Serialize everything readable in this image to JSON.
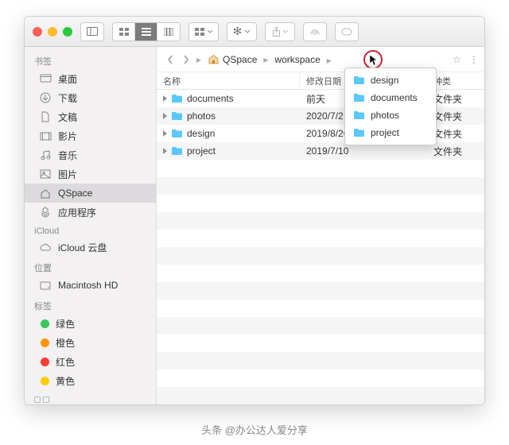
{
  "sidebar": {
    "bookmarks_title": "书签",
    "items": [
      {
        "label": "桌面"
      },
      {
        "label": "下载"
      },
      {
        "label": "文稿"
      },
      {
        "label": "影片"
      },
      {
        "label": "音乐"
      },
      {
        "label": "图片"
      },
      {
        "label": "QSpace"
      },
      {
        "label": "应用程序"
      }
    ],
    "icloud_title": "iCloud",
    "icloud_item": "iCloud 云盘",
    "locations_title": "位置",
    "location_item": "Macintosh HD",
    "tags_title": "标签",
    "tags": [
      {
        "label": "绿色",
        "color": "#34c759"
      },
      {
        "label": "橙色",
        "color": "#ff9500"
      },
      {
        "label": "红色",
        "color": "#ff3b30"
      },
      {
        "label": "黄色",
        "color": "#ffcc00"
      }
    ]
  },
  "breadcrumb": {
    "root": "QSpace",
    "child": "workspace"
  },
  "columns": {
    "name": "名称",
    "modified": "修改日期",
    "kind": "种类"
  },
  "files": [
    {
      "name": "documents",
      "date": "前天",
      "kind": "文件夹"
    },
    {
      "name": "photos",
      "date": "2020/7/2",
      "kind": "文件夹"
    },
    {
      "name": "design",
      "date": "2019/8/26",
      "kind": "文件夹"
    },
    {
      "name": "project",
      "date": "2019/7/10",
      "kind": "文件夹"
    }
  ],
  "menu": [
    "design",
    "documents",
    "photos",
    "project"
  ],
  "watermark": "头条 @办公达人爱分享",
  "colors": {
    "folder": "#5ac8fa",
    "home": "#e8a33d"
  }
}
